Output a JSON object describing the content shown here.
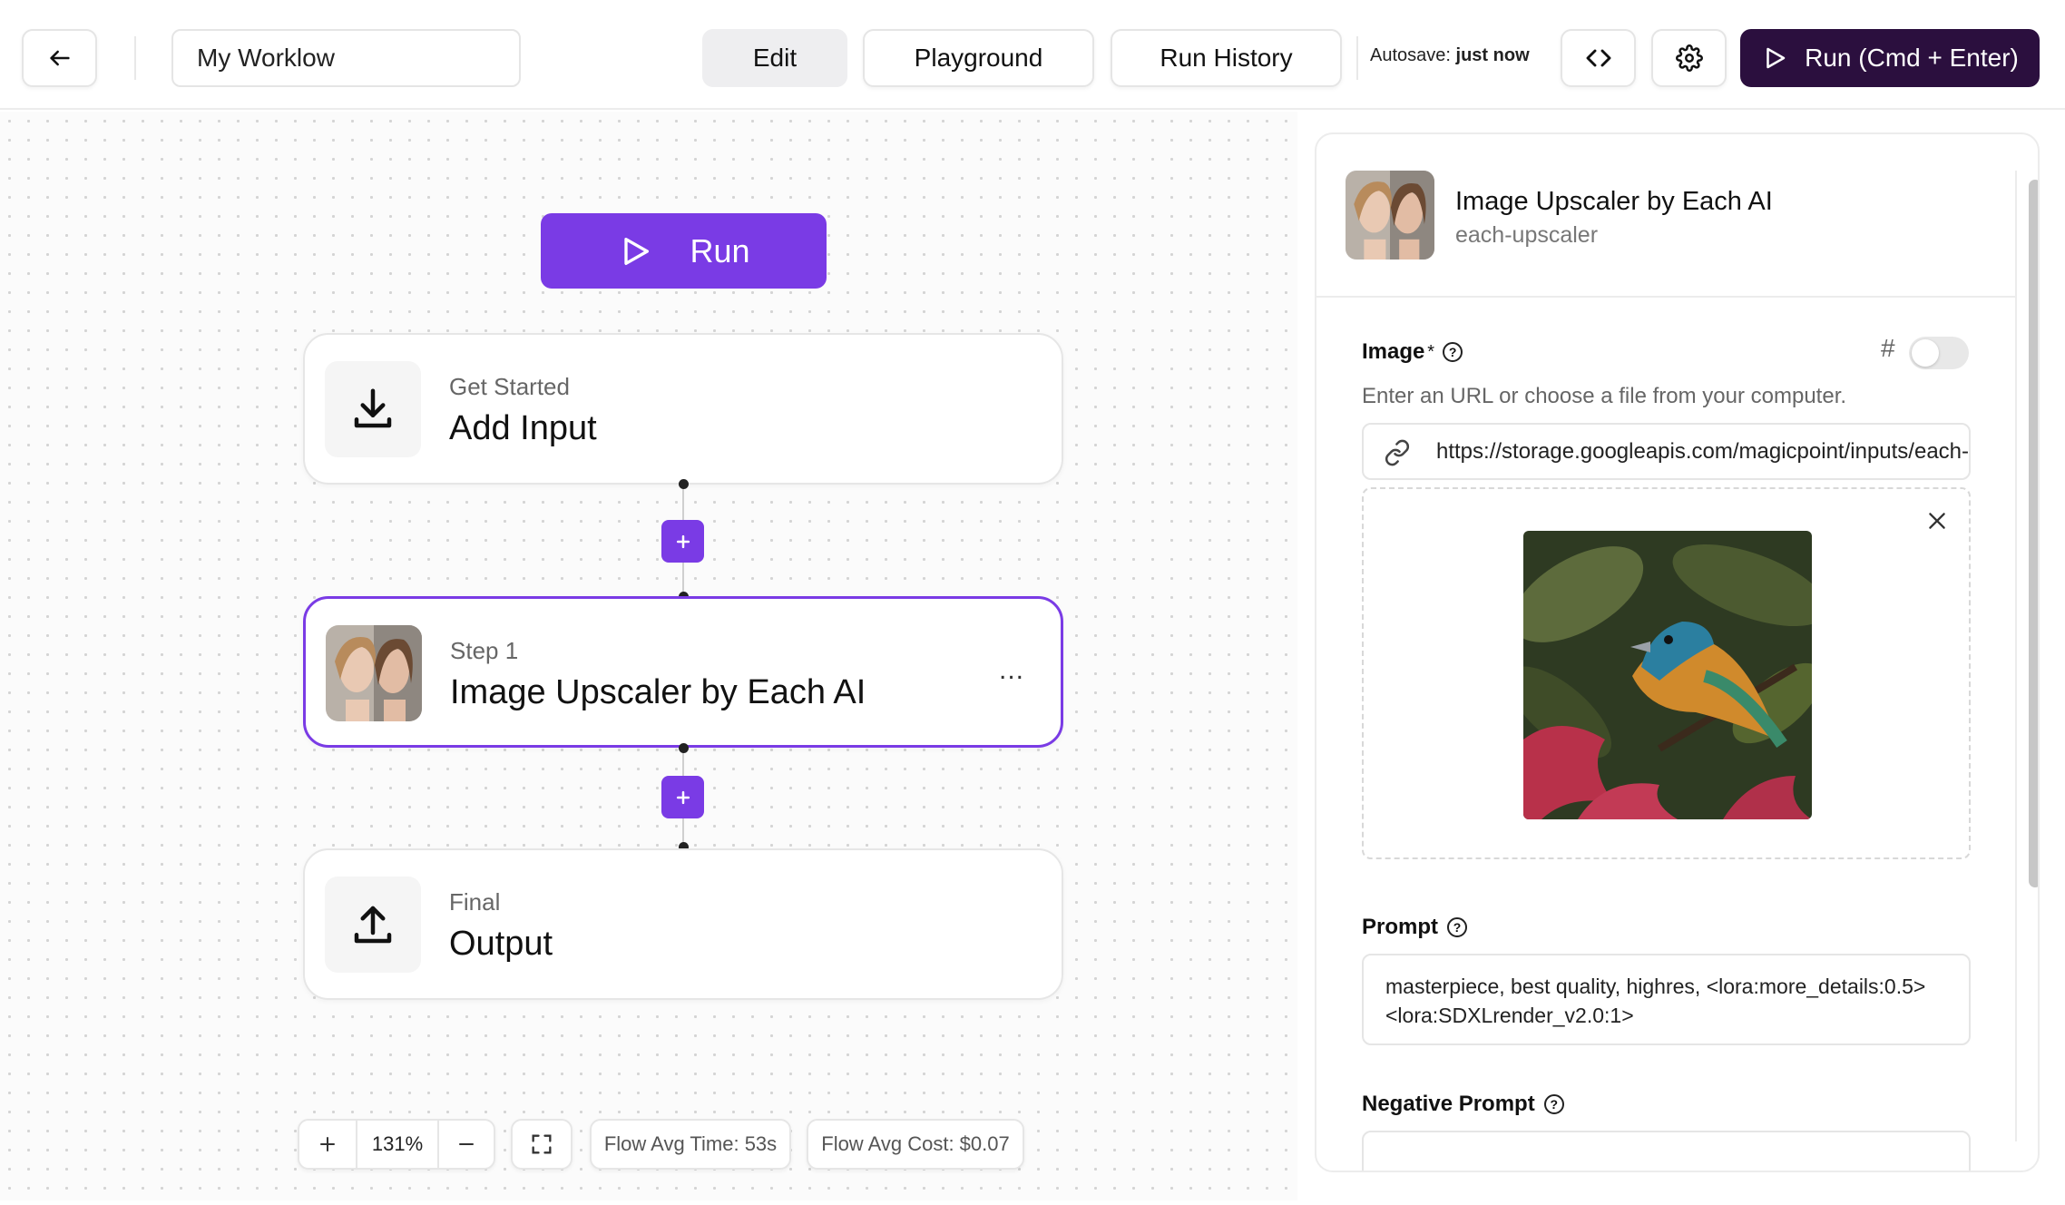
{
  "header": {
    "workflow_name": "My Worklow",
    "tabs": [
      {
        "label": "Edit",
        "active": true
      },
      {
        "label": "Playground",
        "active": false
      },
      {
        "label": "Run History",
        "active": false
      }
    ],
    "autosave_label": "Autosave:",
    "autosave_value": "just now",
    "run_button_label": "Run (Cmd + Enter)"
  },
  "canvas": {
    "run_label": "Run",
    "nodes": [
      {
        "subtitle": "Get Started",
        "title": "Add Input"
      },
      {
        "subtitle": "Step 1",
        "title": "Image Upscaler by Each AI",
        "menu": "..."
      },
      {
        "subtitle": "Final",
        "title": "Output"
      }
    ],
    "zoom": "131%",
    "flow_avg_time": "Flow Avg Time: 53s",
    "flow_avg_cost": "Flow Avg Cost: $0.07"
  },
  "panel": {
    "title": "Image Upscaler by Each AI",
    "slug": "each-upscaler",
    "image_label": "Image",
    "image_required_mark": "*",
    "hash_symbol": "#",
    "image_hint": "Enter an URL or choose a file from your computer.",
    "image_url": "https://storage.googleapis.com/magicpoint/inputs/each-upscaler-input.jpg",
    "prompt_label": "Prompt",
    "prompt_value": "masterpiece, best quality, highres, <lora:more_details:0.5> <lora:SDXLrender_v2.0:1>",
    "negative_prompt_label": "Negative Prompt"
  },
  "colors": {
    "accent": "#7a3be5",
    "run_dark": "#2b0f3e"
  }
}
